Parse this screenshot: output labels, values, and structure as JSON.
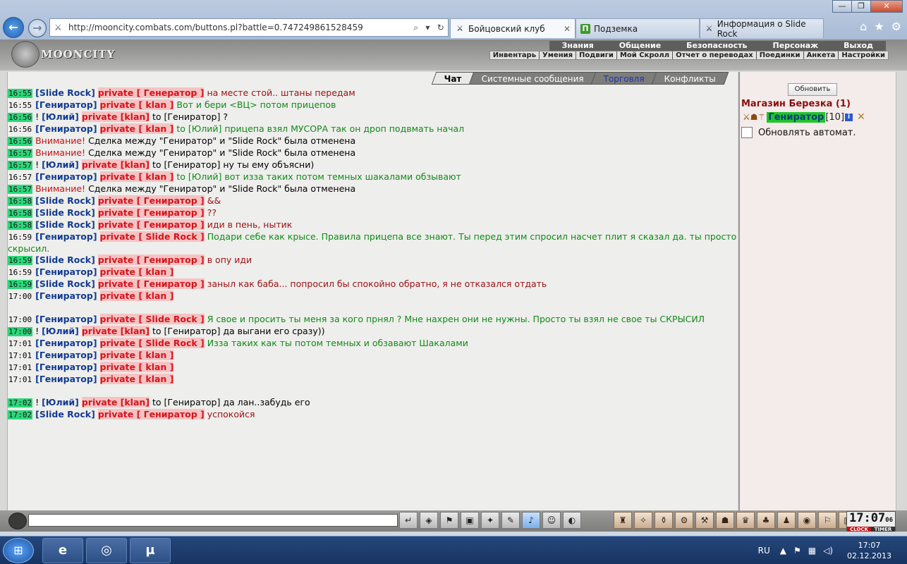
{
  "window": {
    "minimize": "—",
    "maximize": "❐",
    "close": "✕"
  },
  "nav": {
    "back_icon": "arrow-left-icon",
    "forward_icon": "arrow-right-icon"
  },
  "address": {
    "url": "http://mooncity.combats.com/buttons.pl?battle=0.747249861528459",
    "tools": [
      "⌕",
      "▾",
      "↻"
    ]
  },
  "tabs": [
    {
      "label": "Бойцовский клуб",
      "icon": "⚔",
      "active": true
    },
    {
      "label": "Подземка",
      "icon": "П",
      "active": false
    },
    {
      "label": "Информация о Slide Rock",
      "icon": "⚔",
      "active": false
    }
  ],
  "browser_tools": [
    "⌂",
    "★",
    "⚙"
  ],
  "game": {
    "brand": "MOONCITY",
    "menu_top": [
      "Знания",
      "Общение",
      "Безопасность",
      "Персонаж",
      "Выход"
    ],
    "menu_sub": [
      "Инвентарь",
      "Умения",
      "Подвиги",
      "Мой Скролл",
      "Отчет о переводах",
      "Поединки",
      "Анкета",
      "Настройки"
    ]
  },
  "chat_tabs": [
    "Чат",
    "Системные сообщения",
    "Торговля",
    "Конфликты"
  ],
  "chat_lines": [
    {
      "time": "16:55",
      "hl": true,
      "pre": "",
      "nick": "[Slide Rock]",
      "priv": "private [ Генератор ]",
      "pbg": true,
      "text": "на месте стой.. штаны передам",
      "tc": "r"
    },
    {
      "time": "16:55",
      "hl": false,
      "pre": "",
      "nick": "[Гениратор]",
      "priv": "private [ klan ]",
      "pbg": true,
      "text": "Вот и бери <ВЦ> потом прицепов",
      "tc": "g"
    },
    {
      "time": "16:56",
      "hl": true,
      "pre": "! ",
      "nick": "[Юлий]",
      "priv": "private [klan]",
      "pbg": true,
      "text": "to [Гениратор] ?",
      "tc": "b"
    },
    {
      "time": "16:56",
      "hl": false,
      "pre": "",
      "nick": "[Гениратор]",
      "priv": "private [ klan ]",
      "pbg": true,
      "text": "to [Юлий] прицепа взял МУСОРА так он дроп подвмать начал",
      "tc": "g"
    },
    {
      "time": "16:56",
      "hl": true,
      "pre": "",
      "nick": "",
      "priv": "",
      "pbg": false,
      "warn": "Внимание!",
      "text": "Сделка между \"Гениратор\" и \"Slide Rock\" была отменена",
      "tc": "b"
    },
    {
      "time": "16:57",
      "hl": true,
      "pre": "",
      "nick": "",
      "priv": "",
      "pbg": false,
      "warn": "Внимание!",
      "text": "Сделка между \"Гениратор\" и \"Slide Rock\" была отменена",
      "tc": "b"
    },
    {
      "time": "16:57",
      "hl": true,
      "pre": "! ",
      "nick": "[Юлий]",
      "priv": "private [klan]",
      "pbg": true,
      "text": "to [Гениратор] ну ты ему объясни)",
      "tc": "b"
    },
    {
      "time": "16:57",
      "hl": false,
      "pre": "",
      "nick": "[Гениратор]",
      "priv": "private [ klan ]",
      "pbg": true,
      "text": "to [Юлий] вот изза таких потом темных шакалами обзывают",
      "tc": "g"
    },
    {
      "time": "16:57",
      "hl": true,
      "pre": "",
      "nick": "",
      "priv": "",
      "pbg": false,
      "warn": "Внимание!",
      "text": "Сделка между \"Гениратор\" и \"Slide Rock\" была отменена",
      "tc": "b"
    },
    {
      "time": "16:58",
      "hl": true,
      "pre": "",
      "nick": "[Slide Rock]",
      "priv": "private [ Гениратор ]",
      "pbg": true,
      "text": "&&",
      "tc": "r"
    },
    {
      "time": "16:58",
      "hl": true,
      "pre": "",
      "nick": "[Slide Rock]",
      "priv": "private [ Гениратор ]",
      "pbg": true,
      "text": "??",
      "tc": "r"
    },
    {
      "time": "16:58",
      "hl": true,
      "pre": "",
      "nick": "[Slide Rock]",
      "priv": "private [ Гениратор ]",
      "pbg": true,
      "text": "иди в пень, нытик",
      "tc": "r"
    },
    {
      "time": "16:59",
      "hl": false,
      "pre": "",
      "nick": "[Гениратор]",
      "priv": "private [ Slide Rock ]",
      "pbg": true,
      "text": "Подари себе как крысе. Правила прицепа все знают. Ты перед этим спросил насчет плит я сказал да. ты просто скрысил.",
      "tc": "g",
      "wrap": true
    },
    {
      "time": "16:59",
      "hl": true,
      "pre": "",
      "nick": "[Slide Rock]",
      "priv": "private [ Гениратор ]",
      "pbg": true,
      "text": "в опу иди",
      "tc": "r"
    },
    {
      "time": "16:59",
      "hl": false,
      "pre": "",
      "nick": "[Гениратор]",
      "priv": "private [ klan ]",
      "pbg": true,
      "text": "",
      "tc": "g"
    },
    {
      "time": "16:59",
      "hl": true,
      "pre": "",
      "nick": "[Slide Rock]",
      "priv": "private [ Гениратор ]",
      "pbg": true,
      "text": "заныл как баба... попросил бы спокойно обратно, я не отказался отдать",
      "tc": "r"
    },
    {
      "time": "17:00",
      "hl": false,
      "pre": "",
      "nick": "[Гениратор]",
      "priv": "private [ klan ]",
      "pbg": true,
      "text": "",
      "tc": "g"
    },
    {
      "blank": true
    },
    {
      "time": "17:00",
      "hl": false,
      "pre": "",
      "nick": "[Гениратор]",
      "priv": "private [ Slide Rock ]",
      "pbg": true,
      "text": "Я свое и просить ты меня за кого прнял ? Мне нахрен они не нужны. Просто ты взял не свое ты СКРЫСИЛ",
      "tc": "g"
    },
    {
      "time": "17:00",
      "hl": true,
      "pre": "! ",
      "nick": "[Юлий]",
      "priv": "private [klan]",
      "pbg": true,
      "text": "to [Гениратор] да выгани его сразу))",
      "tc": "b"
    },
    {
      "time": "17:01",
      "hl": false,
      "pre": "",
      "nick": "[Гениратор]",
      "priv": "private [ Slide Rock ]",
      "pbg": true,
      "text": "Изза таких как ты потом темных и обзавают Шакалами",
      "tc": "g"
    },
    {
      "time": "17:01",
      "hl": false,
      "pre": "",
      "nick": "[Гениратор]",
      "priv": "private [ klan ]",
      "pbg": true,
      "text": "",
      "tc": "g"
    },
    {
      "time": "17:01",
      "hl": false,
      "pre": "",
      "nick": "[Гениратор]",
      "priv": "private [ klan ]",
      "pbg": true,
      "text": "",
      "tc": "g"
    },
    {
      "time": "17:01",
      "hl": false,
      "pre": "",
      "nick": "[Гениратор]",
      "priv": "private [ klan ]",
      "pbg": true,
      "text": "",
      "tc": "g"
    },
    {
      "blank": true
    },
    {
      "time": "17:02",
      "hl": true,
      "pre": "! ",
      "nick": "[Юлий]",
      "priv": "private [klan]",
      "pbg": true,
      "text": "to [Гениратор] да лан..забудь его",
      "tc": "b"
    },
    {
      "time": "17:02",
      "hl": true,
      "pre": "",
      "nick": "[Slide Rock]",
      "priv": "private [ Гениратор ]",
      "pbg": true,
      "text": "успокойся",
      "tc": "r"
    }
  ],
  "side": {
    "refresh_label": "Обновить",
    "shop_title": "Магазин Березка (1)",
    "user": {
      "name": "Гениратор",
      "level": "[10]",
      "info": "i",
      "remove": "✕"
    },
    "auto_refresh_label": "Обновлять автомат."
  },
  "toolbar": {
    "input_value": "",
    "icons": [
      "↵",
      "◈",
      "⚑",
      "▣",
      "✦",
      "✎",
      "♪",
      "☺",
      "◐"
    ],
    "icons2": [
      "♜",
      "✧",
      "⚱",
      "⚙",
      "⚒",
      "☗",
      "♛",
      "♣",
      "♟",
      "◉",
      "⚐",
      "▥"
    ],
    "clock_time": "17:07",
    "clock_sec": "06",
    "clock_label": "CLOCK",
    "timer_label": "TIMER"
  },
  "taskbar": {
    "start": "⊞",
    "apps": [
      "e",
      "◎",
      "µ"
    ],
    "lang": "RU",
    "time": "17:07",
    "date": "02.12.2013"
  }
}
